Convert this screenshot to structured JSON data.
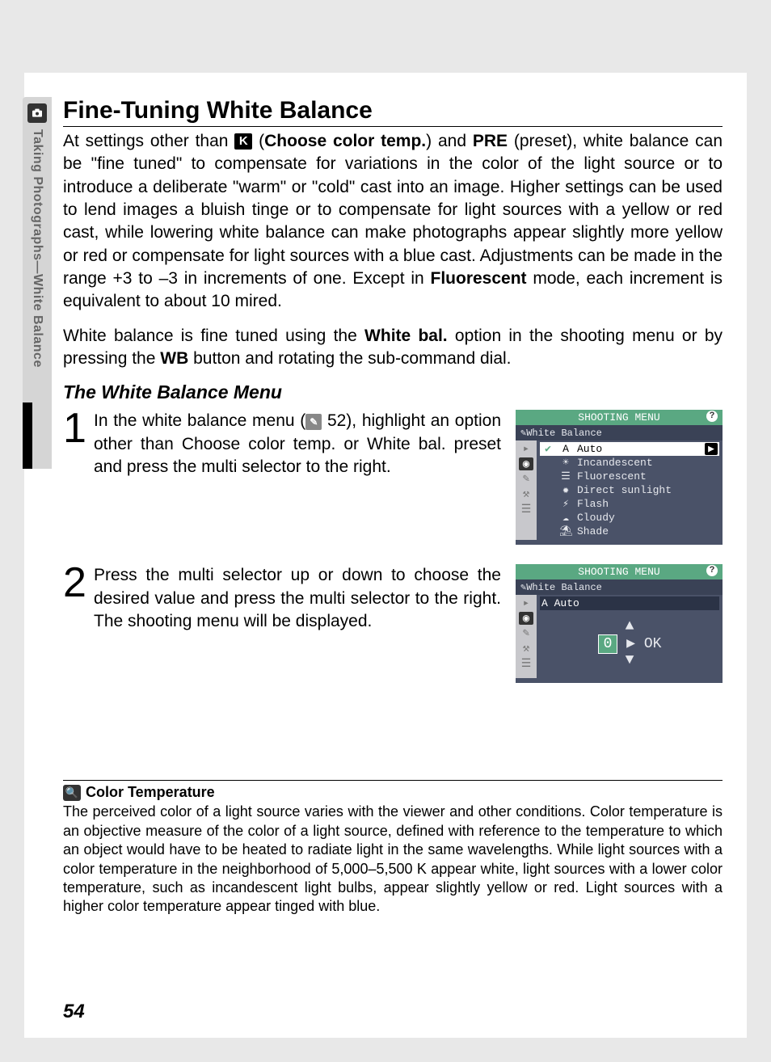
{
  "sidebar": {
    "label": "Taking Photographs—White Balance"
  },
  "title": "Fine-Tuning White Balance",
  "para1_pre": "At settings other than ",
  "para1_k_a": " (",
  "para1_k_b": "Choose color temp.",
  "para1_k_c": ") and ",
  "para1_pre2": "PRE",
  "para1_pre3": " (preset), white balance can be \"fine tuned\" to compensate for variations in the color of the light source or to introduce a deliberate \"warm\" or \"cold\" cast into an image.  Higher settings can be used to lend images a bluish tinge or to compensate for light sources with a yellow or red cast, while lowering white balance can make photographs appear slightly more yellow or red or compensate for light sources with a blue cast.  Adjustments can be made in the range +3 to –3 in increments of one.  Except in ",
  "para1_fluor": "Fluorescent",
  "para1_post": " mode, each increment is equivalent to about 10 mired.",
  "para2_pre": "White balance is fine tuned using the ",
  "para2_wb": "White bal.",
  "para2_mid": " option in the shooting menu or by pressing the ",
  "para2_wbbtn": "WB",
  "para2_post": " button and rotating the sub-command dial.",
  "subheading": "The White Balance Menu",
  "step1": {
    "num": "1",
    "t1": "In the white balance menu (",
    "ref": " 52), highlight an option other than ",
    "b1": "Choose color temp.",
    "t2": " or ",
    "b2": "White bal. preset",
    "t3": " and press the multi selector to the right."
  },
  "step2": {
    "num": "2",
    "text": "Press the multi selector up or down to choose the desired value and press the multi selector to the right.  The shooting menu will be displayed."
  },
  "lcd1": {
    "header": "SHOOTING MENU",
    "sub": "White Balance",
    "items": [
      {
        "icon": "A",
        "label": "Auto",
        "sel": true,
        "check": true
      },
      {
        "icon": "☀",
        "label": "Incandescent"
      },
      {
        "icon": "☰",
        "label": "Fluorescent"
      },
      {
        "icon": "✹",
        "label": "Direct sunlight"
      },
      {
        "icon": "⚡",
        "label": "Flash"
      },
      {
        "icon": "☁",
        "label": "Cloudy"
      },
      {
        "icon": "⛱",
        "label": "Shade"
      }
    ]
  },
  "lcd2": {
    "header": "SHOOTING MENU",
    "sub": "White Balance",
    "mode": "A Auto",
    "value": "0",
    "ok": "OK"
  },
  "note": {
    "title": "Color Temperature",
    "text": "The perceived color of a light source varies with the viewer and other conditions.  Color temperature is an objective measure of the color of a light source, defined with reference to the temperature to which an object would have to be heated to radiate light in the same wavelengths.  While light sources with a color temperature in the neighborhood of 5,000–5,500 K appear white, light sources with a lower color temperature, such as incandescent light bulbs, appear slightly yellow or red.  Light sources with a higher color temperature appear tinged with blue."
  },
  "page_number": "54"
}
